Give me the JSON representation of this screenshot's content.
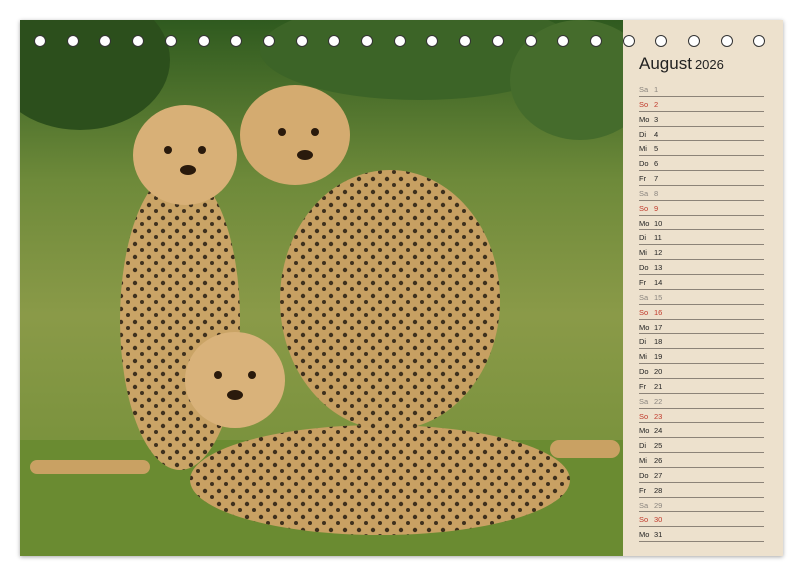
{
  "calendar": {
    "month": "August",
    "year": "2026",
    "days": [
      {
        "weekday": "Sa",
        "day": "1",
        "type": "sat"
      },
      {
        "weekday": "So",
        "day": "2",
        "type": "sun"
      },
      {
        "weekday": "Mo",
        "day": "3",
        "type": "week"
      },
      {
        "weekday": "Di",
        "day": "4",
        "type": "week"
      },
      {
        "weekday": "Mi",
        "day": "5",
        "type": "week"
      },
      {
        "weekday": "Do",
        "day": "6",
        "type": "week"
      },
      {
        "weekday": "Fr",
        "day": "7",
        "type": "week"
      },
      {
        "weekday": "Sa",
        "day": "8",
        "type": "sat"
      },
      {
        "weekday": "So",
        "day": "9",
        "type": "sun"
      },
      {
        "weekday": "Mo",
        "day": "10",
        "type": "week"
      },
      {
        "weekday": "Di",
        "day": "11",
        "type": "week"
      },
      {
        "weekday": "Mi",
        "day": "12",
        "type": "week"
      },
      {
        "weekday": "Do",
        "day": "13",
        "type": "week"
      },
      {
        "weekday": "Fr",
        "day": "14",
        "type": "week"
      },
      {
        "weekday": "Sa",
        "day": "15",
        "type": "sat"
      },
      {
        "weekday": "So",
        "day": "16",
        "type": "sun"
      },
      {
        "weekday": "Mo",
        "day": "17",
        "type": "week"
      },
      {
        "weekday": "Di",
        "day": "18",
        "type": "week"
      },
      {
        "weekday": "Mi",
        "day": "19",
        "type": "week"
      },
      {
        "weekday": "Do",
        "day": "20",
        "type": "week"
      },
      {
        "weekday": "Fr",
        "day": "21",
        "type": "week"
      },
      {
        "weekday": "Sa",
        "day": "22",
        "type": "sat"
      },
      {
        "weekday": "So",
        "day": "23",
        "type": "sun"
      },
      {
        "weekday": "Mo",
        "day": "24",
        "type": "week"
      },
      {
        "weekday": "Di",
        "day": "25",
        "type": "week"
      },
      {
        "weekday": "Mi",
        "day": "26",
        "type": "week"
      },
      {
        "weekday": "Do",
        "day": "27",
        "type": "week"
      },
      {
        "weekday": "Fr",
        "day": "28",
        "type": "week"
      },
      {
        "weekday": "Sa",
        "day": "29",
        "type": "sat"
      },
      {
        "weekday": "So",
        "day": "30",
        "type": "sun"
      },
      {
        "weekday": "Mo",
        "day": "31",
        "type": "week"
      }
    ]
  },
  "photo": {
    "subject": "cheetah-cubs"
  },
  "colors": {
    "sidebar_bg": "#ede1cd",
    "sunday": "#c0392b",
    "saturday": "#8a857f",
    "text": "#222222"
  }
}
